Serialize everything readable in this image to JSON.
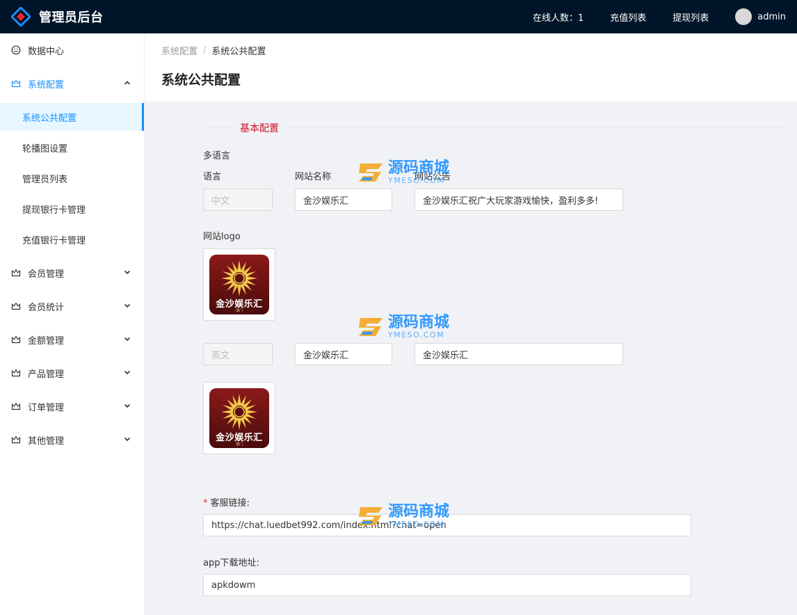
{
  "header": {
    "title": "管理员后台",
    "online_label": "在线人数：",
    "online_count": "1",
    "recharge_link": "充值列表",
    "withdraw_link": "提现列表",
    "username": "admin"
  },
  "sidebar": {
    "items": [
      {
        "label": "数据中心",
        "icon": "smile-icon"
      },
      {
        "label": "系统配置",
        "icon": "crown-icon",
        "expanded": true
      },
      {
        "label": "会员管理",
        "icon": "crown-icon"
      },
      {
        "label": "会员统计",
        "icon": "crown-icon"
      },
      {
        "label": "金额管理",
        "icon": "crown-icon"
      },
      {
        "label": "产品管理",
        "icon": "crown-icon"
      },
      {
        "label": "订单管理",
        "icon": "crown-icon"
      },
      {
        "label": "其他管理",
        "icon": "crown-icon"
      }
    ],
    "subitems": [
      {
        "label": "系统公共配置",
        "selected": true
      },
      {
        "label": "轮播图设置"
      },
      {
        "label": "管理员列表"
      },
      {
        "label": "提现银行卡管理"
      },
      {
        "label": "充值银行卡管理"
      }
    ]
  },
  "breadcrumb": {
    "parent": "系统配置",
    "sep": "/",
    "current": "系统公共配置"
  },
  "page_title": "系统公共配置",
  "form": {
    "section_title": "基本配置",
    "multilang_label": "多语言",
    "col_language": "语言",
    "col_site_name": "网站名称",
    "col_site_notice": "网站公告",
    "logo_label": "网站logo",
    "rows": [
      {
        "language": "中文",
        "site_name": "金沙娱乐汇",
        "site_notice": "金沙娱乐汇祝广大玩家游戏愉快，盈利多多!"
      },
      {
        "language": "英文",
        "site_name": "金沙娱乐汇",
        "site_notice": "金沙娱乐汇"
      }
    ],
    "logo_text": "金沙娱乐汇",
    "logo_subtext": "澳门",
    "service_label": "客服链接:",
    "service_value": "https://chat.luedbet992.com/index.html?chat=open",
    "app_label": "app下载地址:",
    "app_value": "apkdowm"
  },
  "watermark": {
    "cn": "源码商城",
    "en": "YMESO.COM"
  },
  "colors": {
    "header_bg": "#001529",
    "primary": "#1890ff",
    "section_title": "#cf1322",
    "logo_bg": "#8b1a1a"
  }
}
